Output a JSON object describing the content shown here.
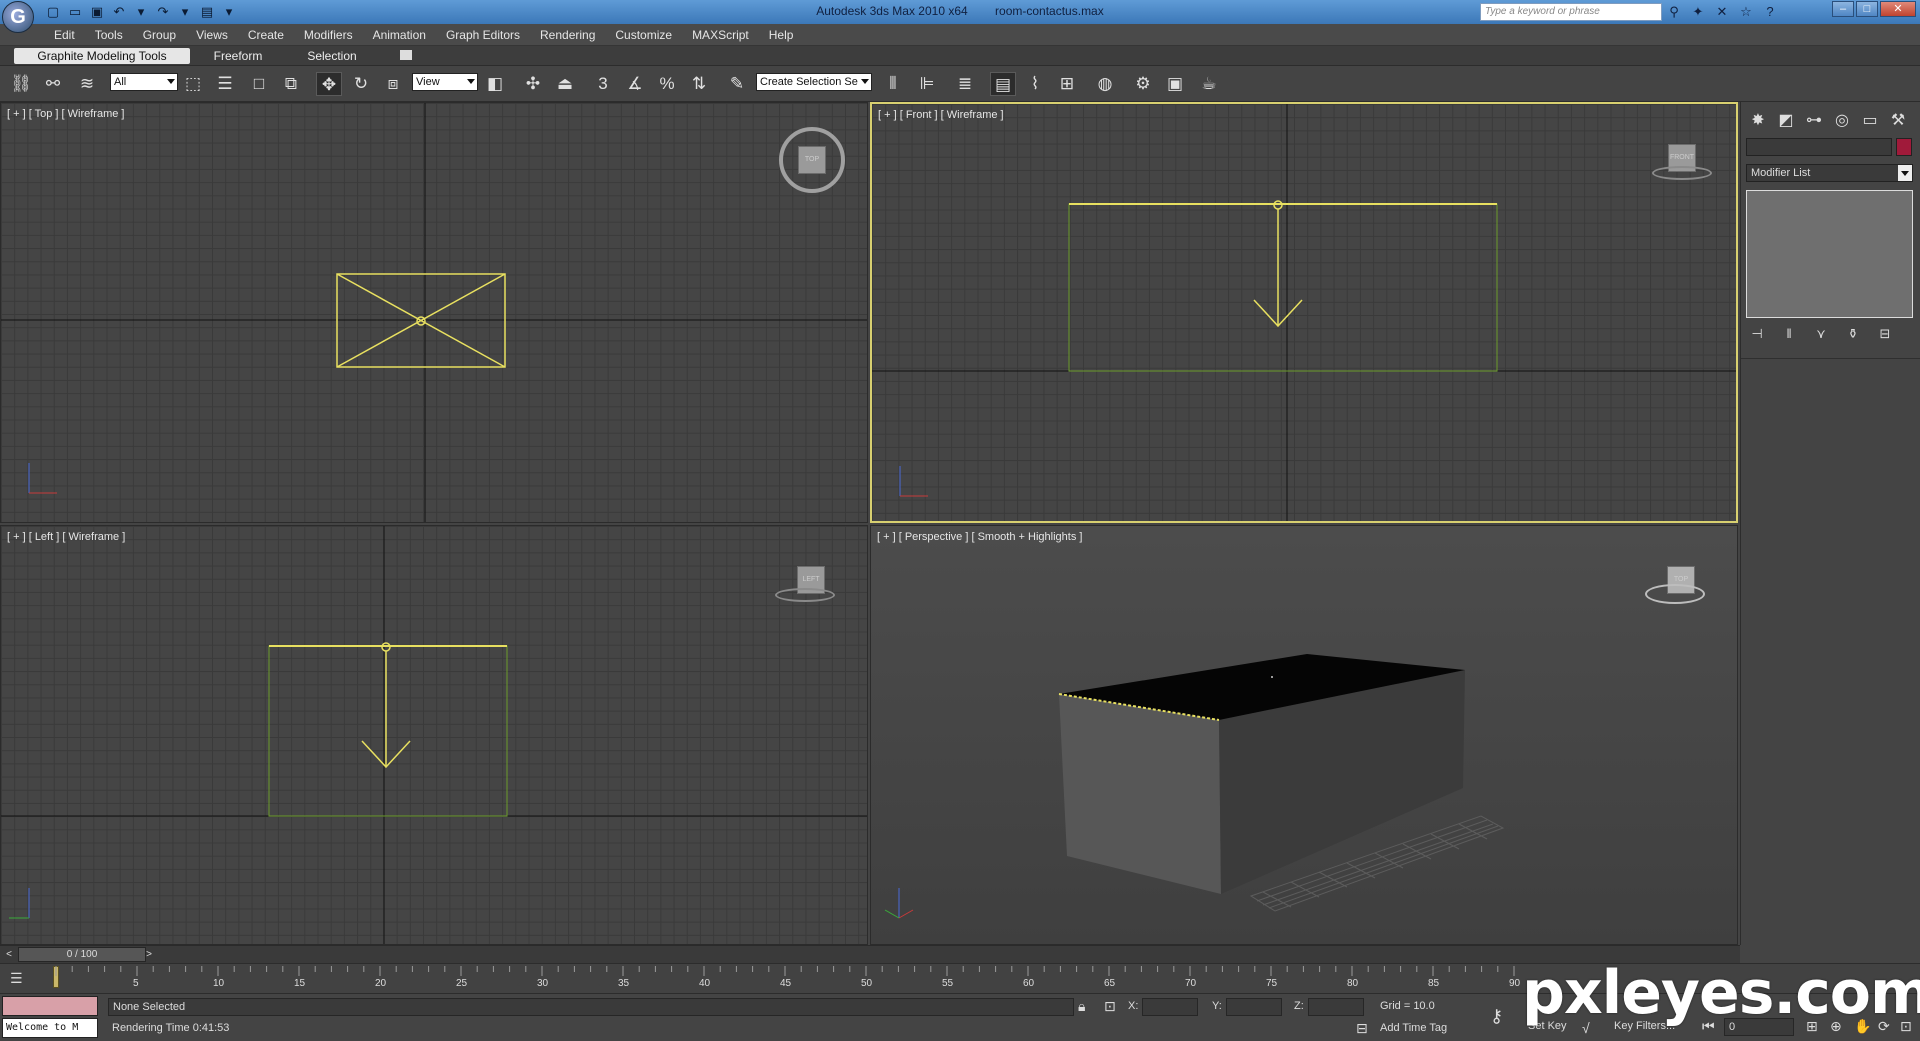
{
  "app": {
    "title": "Autodesk 3ds Max  2010 x64",
    "filename": "room-contactus.max",
    "logo_letter": "G",
    "search_placeholder": "Type a keyword or phrase"
  },
  "menu": [
    "Edit",
    "Tools",
    "Group",
    "Views",
    "Create",
    "Modifiers",
    "Animation",
    "Graph Editors",
    "Rendering",
    "Customize",
    "MAXScript",
    "Help"
  ],
  "ribbon": {
    "tabs": [
      "Graphite Modeling Tools",
      "Freeform",
      "Selection"
    ]
  },
  "toolbar": {
    "filter_value": "All",
    "refcoord_value": "View",
    "named_selection_placeholder": "Create Selection Se",
    "snap_label": "3",
    "angle_snap_label": "",
    "percent_snap_label": "%"
  },
  "viewports": {
    "top": "[ + ] [ Top ] [ Wireframe ]",
    "front": "[ + ] [ Front ] [ Wireframe ]",
    "left": "[ + ] [ Left ] [ Wireframe ]",
    "perspective": "[ + ] [ Perspective ] [ Smooth + Highlights ]",
    "cube_top": "TOP",
    "cube_front": "FRONT",
    "cube_left": "LEFT",
    "cube_persp": "TOP"
  },
  "command_panel": {
    "modifier_list": "Modifier List"
  },
  "timeline": {
    "frame_readout": "0 / 100",
    "prev": "<",
    "next": ">",
    "ticks": [
      "5",
      "10",
      "15",
      "20",
      "25",
      "30",
      "35",
      "40",
      "45",
      "50",
      "55",
      "60",
      "65",
      "70",
      "75",
      "80",
      "85",
      "90"
    ]
  },
  "status": {
    "maxscript_text": "Welcome to M",
    "selection": "None Selected",
    "prompt": "Rendering Time  0:41:53",
    "x_label": "X:",
    "y_label": "Y:",
    "z_label": "Z:",
    "grid": "Grid = 10.0",
    "add_time_tag": "Add Time Tag",
    "set_key": "Set Key",
    "key_filters": "Key Filters...",
    "current_frame": "0"
  },
  "watermark": "pxleyes.com",
  "colors": {
    "selection_yellow": "#e8e060",
    "active_border": "#d8d070",
    "object_color": "#a01a3a"
  }
}
